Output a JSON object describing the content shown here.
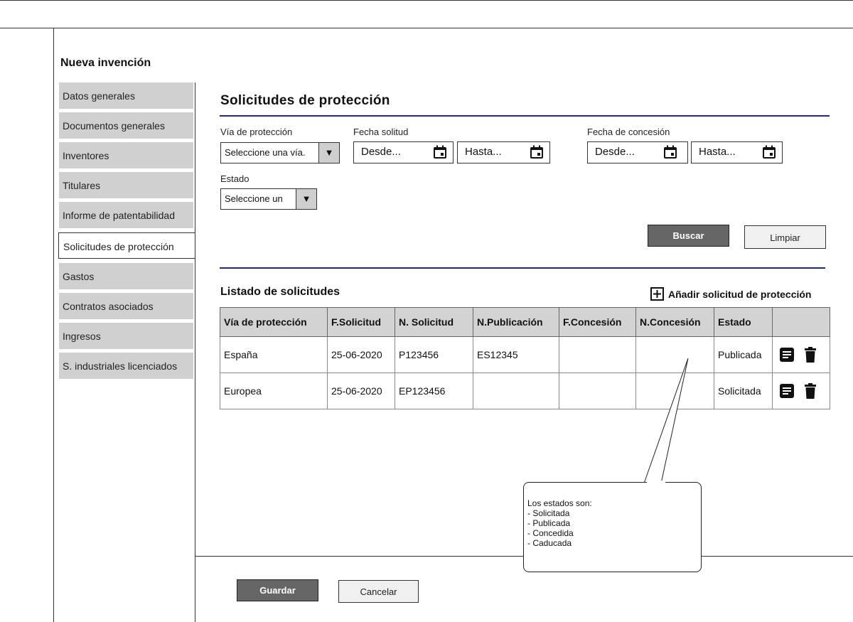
{
  "page": {
    "title": "Nueva invención"
  },
  "sidebar": {
    "items": [
      {
        "label": "Datos generales"
      },
      {
        "label": "Documentos generales"
      },
      {
        "label": "Inventores"
      },
      {
        "label": "Titulares"
      },
      {
        "label": "Informe de patentabilidad"
      },
      {
        "label": "Solicitudes de protección",
        "active": true
      },
      {
        "label": "Gastos"
      },
      {
        "label": "Contratos asociados"
      },
      {
        "label": "Ingresos"
      },
      {
        "label": "S. industriales licenciados"
      }
    ]
  },
  "section": {
    "title": "Solicitudes de protección"
  },
  "filters": {
    "via": {
      "label": "Vía de protección",
      "value": "Seleccione una vía."
    },
    "fecha_solicitud": {
      "label": "Fecha solitud",
      "from": "Desde...",
      "to": "Hasta..."
    },
    "fecha_concesion": {
      "label": "Fecha de concesión",
      "from": "Desde...",
      "to": "Hasta..."
    },
    "estado": {
      "label": "Estado",
      "value": "Seleccione un"
    },
    "search_label": "Buscar",
    "clear_label": "Limpiar"
  },
  "list": {
    "title": "Listado de solicitudes",
    "add_label": "Añadir solicitud de protección",
    "columns": [
      "Vía de protección",
      "F.Solicitud",
      "N. Solicitud",
      "N.Publicación",
      "F.Concesión",
      "N.Concesión",
      "Estado",
      ""
    ],
    "rows": [
      {
        "via": "España",
        "f_solicitud": "25-06-2020",
        "n_solicitud": "P123456",
        "n_publicacion": "ES12345",
        "f_concesion": "",
        "n_concesion": "",
        "estado": "Publicada"
      },
      {
        "via": "Europea",
        "f_solicitud": "25-06-2020",
        "n_solicitud": "EP123456",
        "n_publicacion": "",
        "f_concesion": "",
        "n_concesion": "",
        "estado": "Solicitada"
      }
    ]
  },
  "callout": {
    "lines": [
      "Los estados son:",
      "- Solicitada",
      "- Publicada",
      "- Concedida",
      "- Caducada"
    ]
  },
  "footer": {
    "save_label": "Guardar",
    "cancel_label": "Cancelar"
  },
  "colors": {
    "accent_line": "#1f2a7a",
    "sidebar_bg": "#d0d0d0",
    "dark_button": "#666666"
  }
}
